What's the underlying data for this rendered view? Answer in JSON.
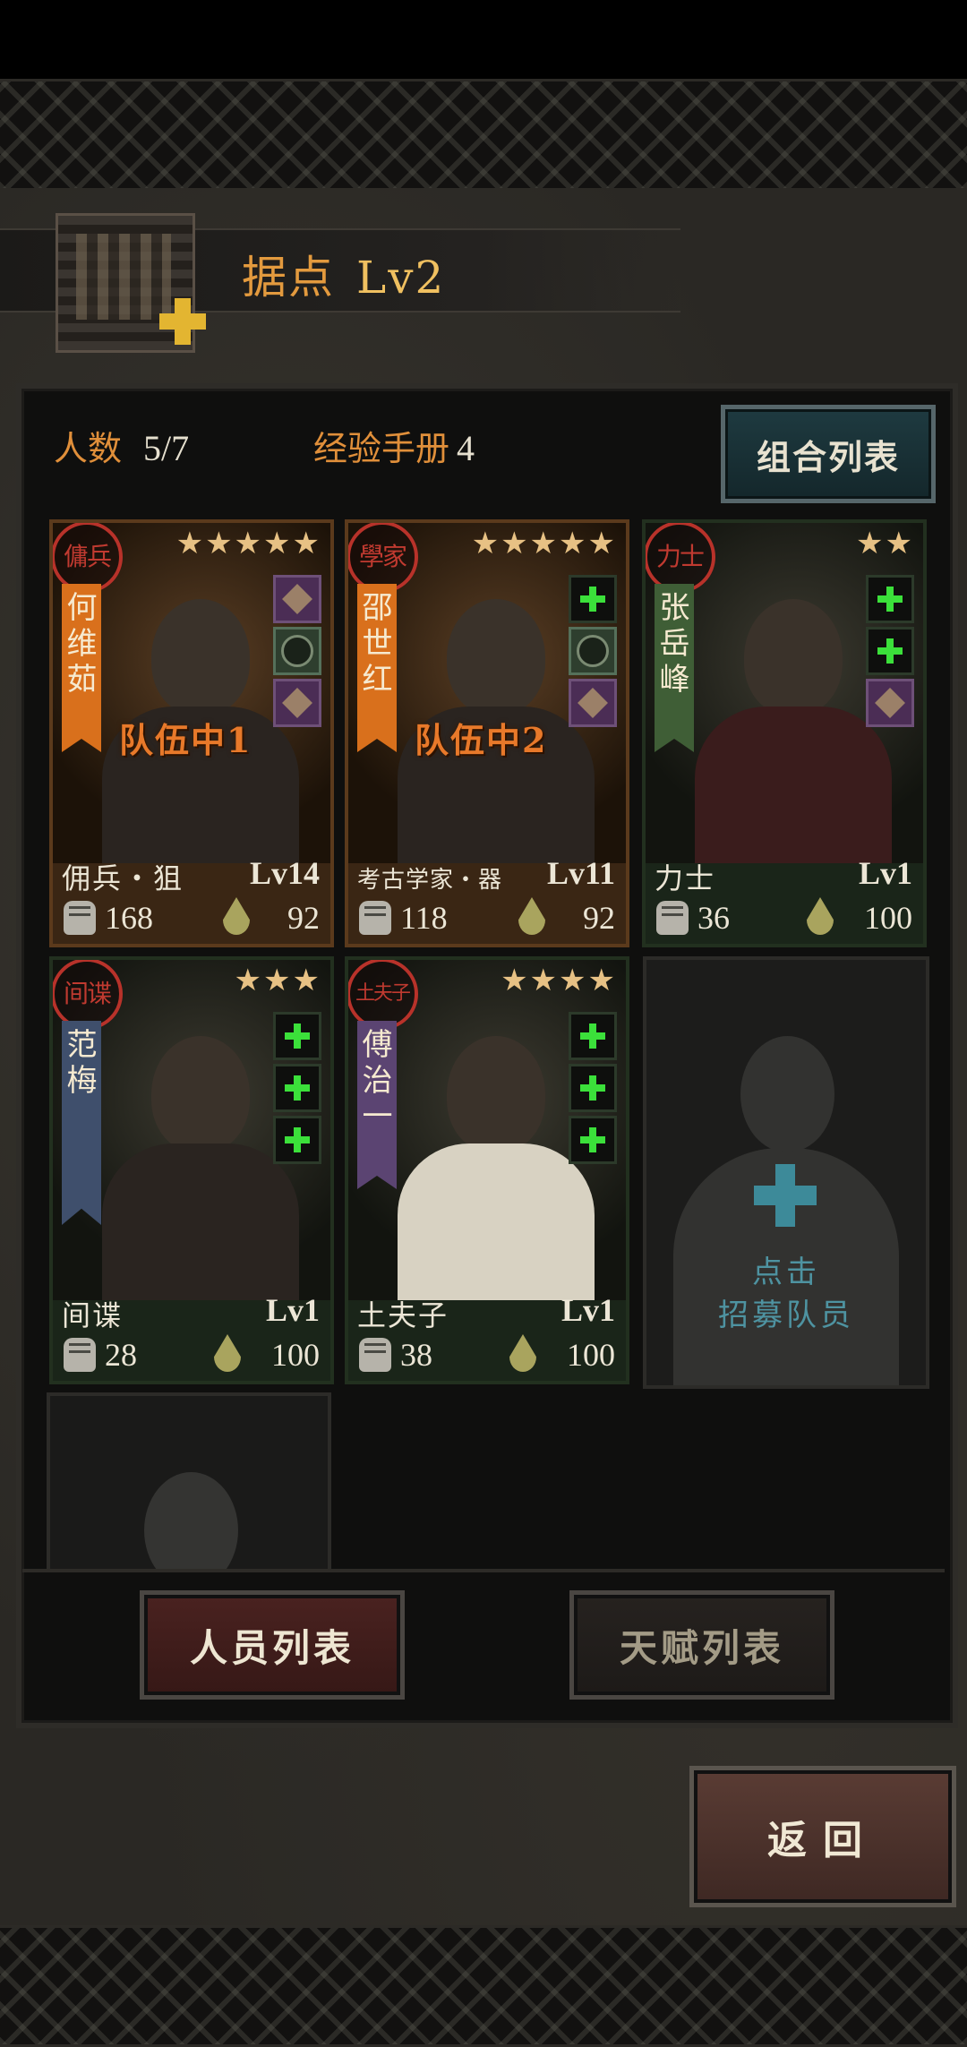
{
  "header": {
    "title": "据点",
    "level": "Lv2"
  },
  "stats": {
    "headcount_label": "人数",
    "headcount_value": "5/7",
    "exp_book_label": "经验手册",
    "exp_book_value": "4"
  },
  "combo_button": "组合列表",
  "members": [
    {
      "role_seal": "傭兵",
      "name": "何维茹",
      "stars": "★★★★★",
      "team": "队伍中1",
      "cls": "佣兵・狙",
      "level": "Lv14",
      "power": "168",
      "hp": "92",
      "banner_color": "orange"
    },
    {
      "role_seal": "學家",
      "name": "邵世红",
      "stars": "★★★★★",
      "team": "队伍中2",
      "cls": "考古学家・器",
      "level": "Lv11",
      "power": "118",
      "hp": "92",
      "banner_color": "orange"
    },
    {
      "role_seal": "力士",
      "name": "张岳峰",
      "stars": "★★",
      "team": "",
      "cls": "力士",
      "level": "Lv1",
      "power": "36",
      "hp": "100",
      "banner_color": "green"
    },
    {
      "role_seal": "间谍",
      "name": "范梅",
      "stars": "★★★",
      "team": "",
      "cls": "间谍",
      "level": "Lv1",
      "power": "28",
      "hp": "100",
      "banner_color": "blue"
    },
    {
      "role_seal": "土夫子",
      "name": "傅治一",
      "stars": "★★★★",
      "team": "",
      "cls": "土夫子",
      "level": "Lv1",
      "power": "38",
      "hp": "100",
      "banner_color": "purple"
    }
  ],
  "recruit": {
    "line1": "点击",
    "line2": "招募队员"
  },
  "tabs": {
    "personnel": "人员列表",
    "talent": "天赋列表"
  },
  "back_button": "返回",
  "colors": {
    "accent_orange": "#e39a3e",
    "team_orange": "#e8792a",
    "recruit_teal": "#4e93a1",
    "add_green": "#3be03a"
  }
}
